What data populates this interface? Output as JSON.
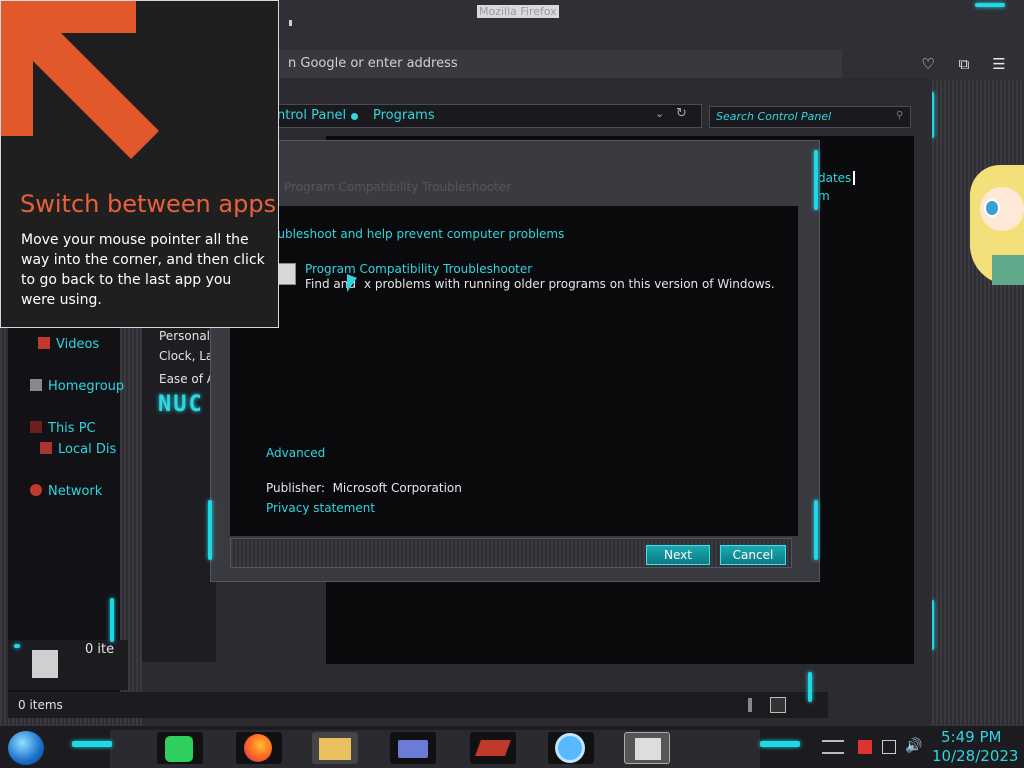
{
  "browser": {
    "title": "Mozilla Firefox",
    "address_placeholder": "Search with Google or enter address",
    "address_visible": "n Google or enter address"
  },
  "control_panel": {
    "breadcrumb": [
      "ntrol Panel",
      "Programs"
    ],
    "search_placeholder": "Search Control Panel",
    "right_partial": [
      "dates",
      "m"
    ],
    "left_partial": [
      "Personaliz",
      "Clock, Lar",
      "Ease of Ac"
    ]
  },
  "explorer": {
    "nav": [
      {
        "label": "Videos",
        "icon": "video-icon"
      },
      {
        "label": "Homegroup",
        "icon": "homegroup-icon"
      },
      {
        "label": "This PC",
        "icon": "computer-icon"
      },
      {
        "label": "Local Dis",
        "icon": "disk-icon"
      },
      {
        "label": "Network",
        "icon": "network-icon"
      }
    ],
    "footer_partial": "0 ite",
    "status": "0 items"
  },
  "dialog": {
    "title": "Program Compatibility Troubleshooter",
    "heading": "oubleshoot and help prevent computer problems",
    "item_title": "Program Compatibility Troubleshooter",
    "item_desc_start": "Find and",
    "item_desc_end": "x problems with running older programs on this version of Windows.",
    "advanced": "Advanced",
    "publisher_label": "Publisher:",
    "publisher_value": "Microsoft Corporation",
    "privacy": "Privacy statement",
    "next": "Next",
    "cancel": "Cancel"
  },
  "tip": {
    "title": "Switch between apps",
    "text": "Move your mouse pointer all the way into the corner, and then click to go back to the last app you were using."
  },
  "taskbar": {
    "apps": [
      "notes-app-icon",
      "firefox-icon",
      "file-explorer-icon",
      "id-card-app-icon",
      "media-app-icon",
      "weather-app-icon",
      "troubleshooter-app-icon"
    ],
    "time": "5:49 PM",
    "date": "10/28/2023"
  },
  "colors": {
    "accent": "#2fd6e0",
    "tip_title": "#e8613a",
    "tip_arrow": "#e0582c"
  }
}
